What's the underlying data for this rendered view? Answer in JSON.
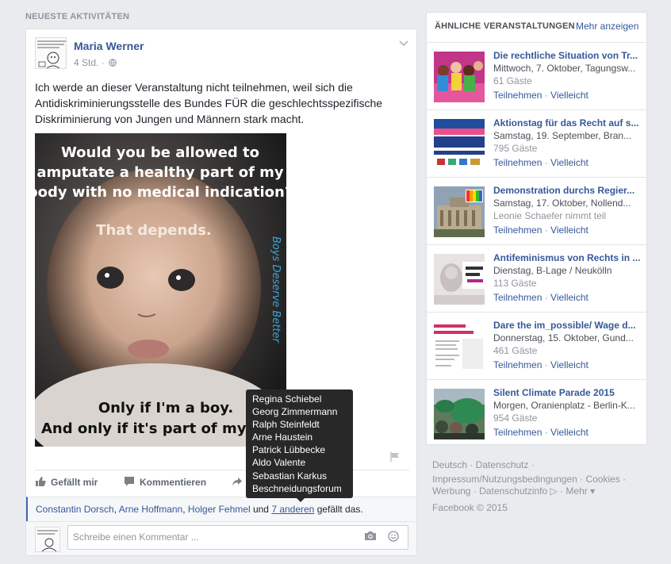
{
  "feed": {
    "section_title": "NEUESTE AKTIVITÄTEN"
  },
  "post": {
    "author": "Maria Werner",
    "time": "4 Std. ·",
    "text": "Ich werde an dieser Veranstaltung nicht teilnehmen, weil sich die Antidiskriminierungsstelle des Bundes FÜR die geschlechtsspezifische Diskriminierung von Jungen und Männern stark macht.",
    "image_lines": {
      "line1": "Would you be allowed to",
      "line2": "amputate a healthy part of my",
      "line3": "body with no medical indication?",
      "line4": "That depends.",
      "line5": "Only if I'm a boy.",
      "line6": "And only if it's part of my gen",
      "side": "Boys Deserve Better"
    },
    "actions": {
      "like": "Gefällt mir",
      "comment": "Kommentieren"
    },
    "likes": {
      "names": [
        "Constantin Dorsch",
        "Arne Hoffmann",
        "Holger Fehmel"
      ],
      "sep1": ", ",
      "sep2": ", ",
      "and": " und ",
      "more": "7 anderen",
      "suffix": " gefällt das."
    },
    "comment_placeholder": "Schreibe einen Kommentar ...",
    "tooltip_names": [
      "Regina Schiebel",
      "Georg Zimmermann",
      "Ralph Steinfeldt",
      "Arne Haustein",
      "Patrick Lübbecke",
      "Aldo Valente",
      "Sebastian Karkus",
      "Beschneidungsforum"
    ]
  },
  "events": {
    "heading": "ÄHNLICHE VERANSTALTUNGEN",
    "more_link": "Mehr anzeigen",
    "join_label": "Teilnehmen",
    "maybe_label": "Vielleicht",
    "items": [
      {
        "title": "Die rechtliche Situation von Tr...",
        "date": "Mittwoch, 7. Oktober, Tagungsw...",
        "guests": "61 Gäste",
        "thumb": "colorful-group"
      },
      {
        "title": "Aktionstag für das Recht auf s...",
        "date": "Samstag, 19. September, Bran...",
        "guests": "795 Gäste",
        "thumb": "banner-blue"
      },
      {
        "title": "Demonstration durchs Regier...",
        "date": "Samstag, 17. Oktober, Nollend...",
        "guests": "Leonie Schaefer nimmt teil",
        "thumb": "reichstag"
      },
      {
        "title": "Antifeminismus von Rechts in ...",
        "date": "Dienstag, B-Lage / Neukölln",
        "guests": "113 Gäste",
        "thumb": "poster-woman"
      },
      {
        "title": "Dare the im_possible/ Wage d...",
        "date": "Donnerstag, 15. Oktober, Gund...",
        "guests": "461 Gäste",
        "thumb": "flyer-white"
      },
      {
        "title": "Silent Climate Parade 2015",
        "date": "Morgen, Oranienplatz - Berlin-K...",
        "guests": "954 Gäste",
        "thumb": "crowd-green"
      }
    ]
  },
  "footer": {
    "line1": "Deutsch · Datenschutz ·",
    "line2": "Impressum/Nutzungsbedingungen · Cookies ·",
    "line3": "Werbung · Datenschutzinfo ▷ · Mehr ▾",
    "copyright": "Facebook © 2015"
  }
}
